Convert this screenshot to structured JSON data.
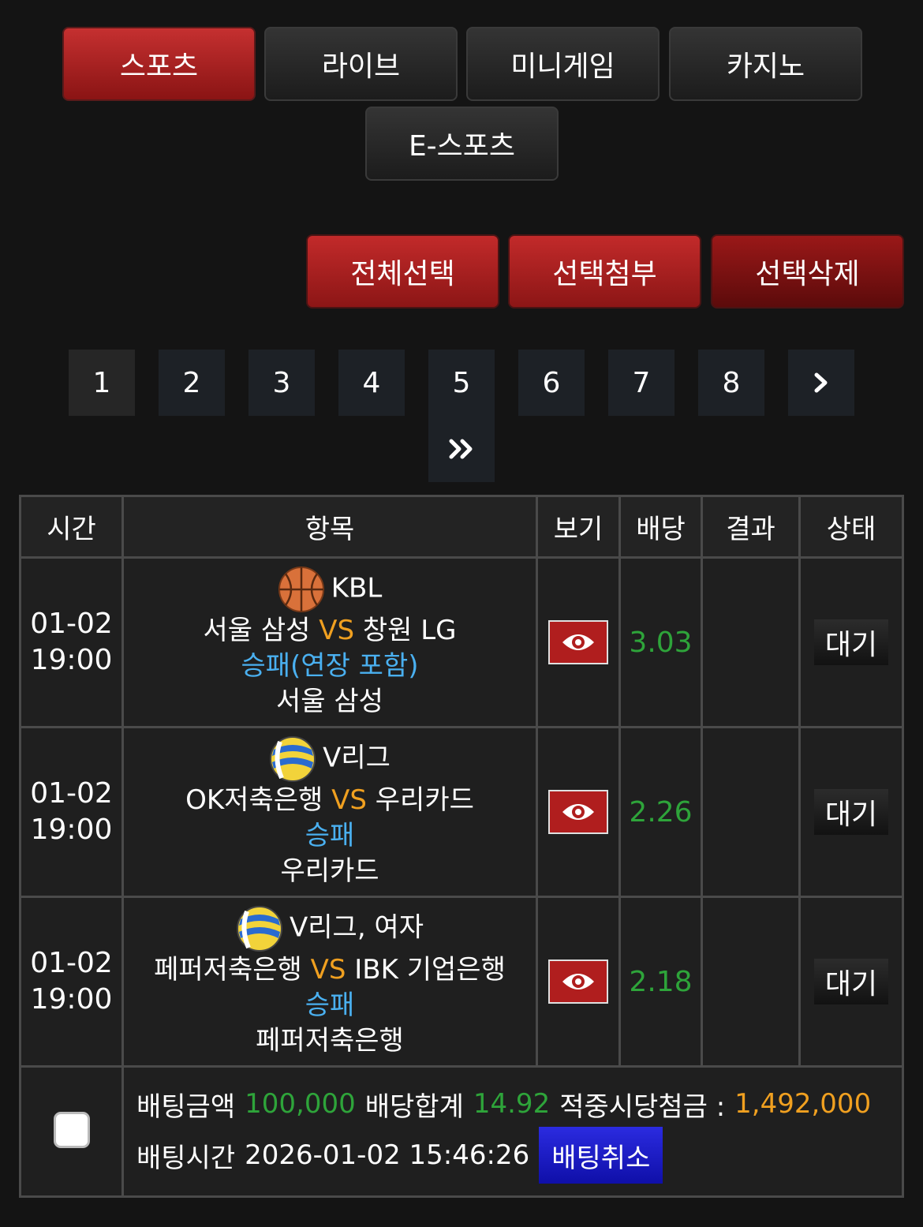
{
  "tabs": [
    "스포츠",
    "라이브",
    "미니게임",
    "카지노",
    "E-스포츠"
  ],
  "actions": {
    "select_all": "전체선택",
    "attach_selected": "선택첨부",
    "delete_selected": "선택삭제"
  },
  "pagination": {
    "pages": [
      "1",
      "2",
      "3",
      "4",
      "5",
      "6",
      "7",
      "8"
    ],
    "next": "›",
    "last": "»",
    "current": "1"
  },
  "table": {
    "headers": {
      "time": "시간",
      "item": "항목",
      "view": "보기",
      "odds": "배당",
      "result": "결과",
      "status": "상태"
    },
    "rows": [
      {
        "date": "01-02",
        "time": "19:00",
        "sport_icon": "basketball-icon",
        "league": "KBL",
        "home": "서울 삼성",
        "vs": "VS",
        "away": "창원 LG",
        "market": "승패(연장 포함)",
        "pick": "서울 삼성",
        "odds": "3.03",
        "result": "",
        "status": "대기"
      },
      {
        "date": "01-02",
        "time": "19:00",
        "sport_icon": "volleyball-icon",
        "league": "V리그",
        "home": "OK저축은행",
        "vs": "VS",
        "away": "우리카드",
        "market": "승패",
        "pick": "우리카드",
        "odds": "2.26",
        "result": "",
        "status": "대기"
      },
      {
        "date": "01-02",
        "time": "19:00",
        "sport_icon": "volleyball-icon",
        "league": "V리그, 여자",
        "home": "페퍼저축은행",
        "vs": "VS",
        "away": "IBK 기업은행",
        "market": "승패",
        "pick": "페퍼저축은행",
        "odds": "2.18",
        "result": "",
        "status": "대기"
      }
    ]
  },
  "summary": {
    "bet_amount_label": "배팅금액",
    "bet_amount": "100,000",
    "odds_total_label": "배당합계",
    "odds_total": "14.92",
    "payout_label": "적중시당첨금 :",
    "payout": "1,492,000",
    "bet_time_label": "배팅시간",
    "bet_time": "2026-01-02 15:46:26",
    "cancel_label": "배팅취소"
  },
  "colors": {
    "accent_red": "#b01e1e",
    "odds_green": "#2ea43a",
    "vs_orange": "#f0a020",
    "market_blue": "#4ab0f0",
    "cancel_blue": "#1a1ac8"
  }
}
